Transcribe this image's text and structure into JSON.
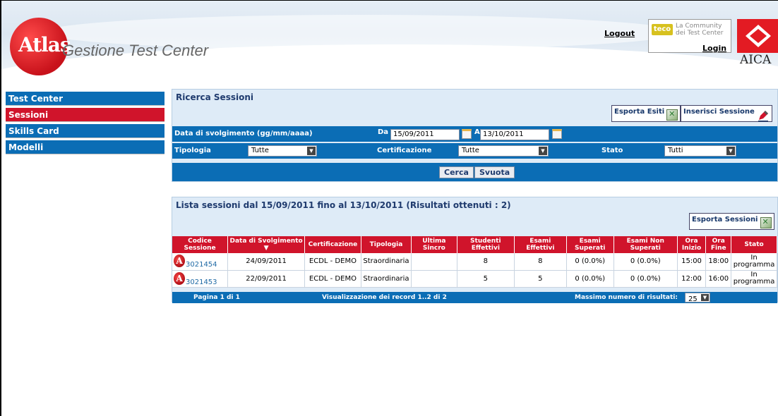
{
  "header": {
    "logo_text": "Atlas",
    "app_title": "Gestione Test Center",
    "logout": "Logout",
    "teco_badge": "teco",
    "teco_line1": "La Community",
    "teco_line2": "dei Test Center",
    "login": "Login",
    "aica": "AICA"
  },
  "sidebar": {
    "items": [
      {
        "label": "Test Center"
      },
      {
        "label": "Sessioni"
      },
      {
        "label": "Skills Card"
      },
      {
        "label": "Modelli"
      }
    ]
  },
  "search": {
    "title": "Ricerca Sessioni",
    "export_results": "Esporta Esiti",
    "insert_session": "Inserisci Sessione",
    "date_label": "Data di svolgimento (gg/mm/aaaa)",
    "da_label": "Da",
    "date_from": "15/09/2011",
    "a_label": "A",
    "date_to": "13/10/2011",
    "tipologia_label": "Tipologia",
    "tipologia_value": "Tutte",
    "certificazione_label": "Certificazione",
    "certificazione_value": "Tutte",
    "stato_label": "Stato",
    "stato_value": "Tutti",
    "cerca": "Cerca",
    "svuota": "Svuota"
  },
  "results": {
    "title": "Lista sessioni dal 15/09/2011 fino al 13/10/2011 (Risultati ottenuti : 2)",
    "export_sessions": "Esporta Sessioni",
    "columns": [
      "Codice Sessione",
      "Data di Svolgimento ▼",
      "Certificazione",
      "Tipologia",
      "Ultima Sincro",
      "Studenti Effettivi",
      "Esami Effettivi",
      "Esami Superati",
      "Esami Non Superati",
      "Ora Inizio",
      "Ora Fine",
      "Stato"
    ],
    "rows": [
      {
        "code": "3021454",
        "date": "24/09/2011",
        "cert": "ECDL - DEMO",
        "tipo": "Straordinaria",
        "sync": "",
        "students": "8",
        "exams": "8",
        "passed": "0 (0.0%)",
        "failed": "0 (0.0%)",
        "start": "15:00",
        "end": "18:00",
        "status": "In programma"
      },
      {
        "code": "3021453",
        "date": "22/09/2011",
        "cert": "ECDL - DEMO",
        "tipo": "Straordinaria",
        "sync": "",
        "students": "5",
        "exams": "5",
        "passed": "0 (0.0%)",
        "failed": "0 (0.0%)",
        "start": "12:00",
        "end": "16:00",
        "status": "In programma"
      }
    ],
    "page_info": "Pagina 1 di 1",
    "records_info": "Visualizzazione dei record 1..2 di 2",
    "max_label": "Massimo numero di risultati:",
    "max_value": "25"
  }
}
